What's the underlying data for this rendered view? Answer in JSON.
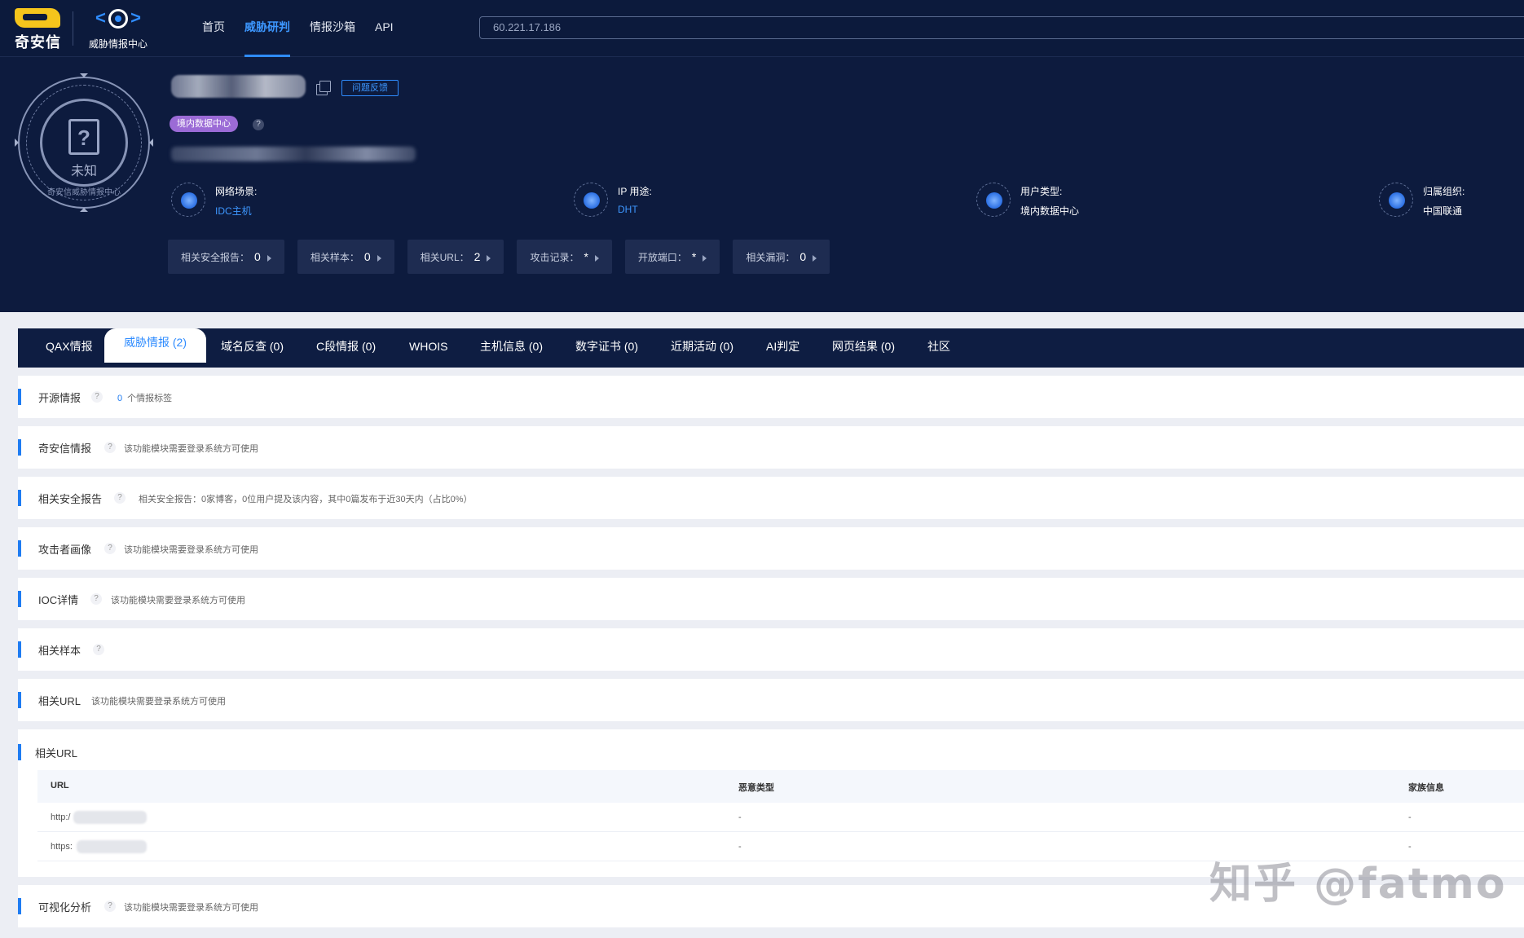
{
  "brand": {
    "name": "奇安信",
    "product": "威胁情报中心"
  },
  "nav": {
    "items": [
      "首页",
      "威胁研判",
      "情报沙箱",
      "API"
    ],
    "active_index": 1
  },
  "search": {
    "value": "60.221.17.186"
  },
  "hero": {
    "badge_label": "未知",
    "badge_arc_text": "奇安信威胁情报中心",
    "feedback_label": "问题反馈",
    "tag": "境内数据中心",
    "help": "?",
    "facts": [
      {
        "key": "网络场景:",
        "value": "IDC主机",
        "value_color": "#3d97ff",
        "icon": "network-scene-icon"
      },
      {
        "key": "IP 用途:",
        "value": "DHT",
        "value_color": "#3d97ff",
        "icon": "ip-usage-icon"
      },
      {
        "key": "用户类型:",
        "value": "境内数据中心",
        "value_color": "#ffffff",
        "icon": "user-type-icon"
      },
      {
        "key": "归属组织:",
        "value": "中国联通",
        "value_color": "#ffffff",
        "icon": "organization-icon"
      }
    ],
    "stats": [
      {
        "label": "相关安全报告：",
        "value": "0"
      },
      {
        "label": "相关样本：",
        "value": "0"
      },
      {
        "label": "相关URL：",
        "value": "2"
      },
      {
        "label": "攻击记录：",
        "value": "*"
      },
      {
        "label": "开放端口：",
        "value": "*"
      },
      {
        "label": "相关漏洞：",
        "value": "0"
      }
    ]
  },
  "tabs": [
    "QAX情报",
    "威胁情报 (2)",
    "域名反查 (0)",
    "C段情报 (0)",
    "WHOIS",
    "主机信息 (0)",
    "数字证书 (0)",
    "近期活动 (0)",
    "AI判定",
    "网页结果 (0)",
    "社区"
  ],
  "active_tab_index": 1,
  "sections": {
    "open_source": {
      "title": "开源情报",
      "count": "0",
      "note": "个情报标签"
    },
    "qianxin": {
      "title": "奇安信情报",
      "note": "该功能模块需要登录系统方可使用"
    },
    "reports": {
      "title": "相关安全报告",
      "note": "相关安全报告：0家博客，0位用户提及该内容，其中0篇发布于近30天内（占比0%）"
    },
    "attacker": {
      "title": "攻击者画像",
      "note": "该功能模块需要登录系统方可使用"
    },
    "ioc": {
      "title": "IOC详情",
      "note": "该功能模块需要登录系统方可使用"
    },
    "samples": {
      "title": "相关样本"
    },
    "url_locked": {
      "title": "相关URL",
      "note": "该功能模块需要登录系统方可使用"
    },
    "url_table": {
      "title": "相关URL",
      "columns": [
        "URL",
        "恶意类型",
        "家族信息"
      ],
      "rows": [
        {
          "url": "http:/",
          "type": "-",
          "family": "-"
        },
        {
          "url": "https:",
          "type": "-",
          "family": "-"
        }
      ]
    },
    "visual": {
      "title": "可视化分析",
      "note": "该功能模块需要登录系统方可使用"
    }
  },
  "watermark": "知乎 @fatmo"
}
